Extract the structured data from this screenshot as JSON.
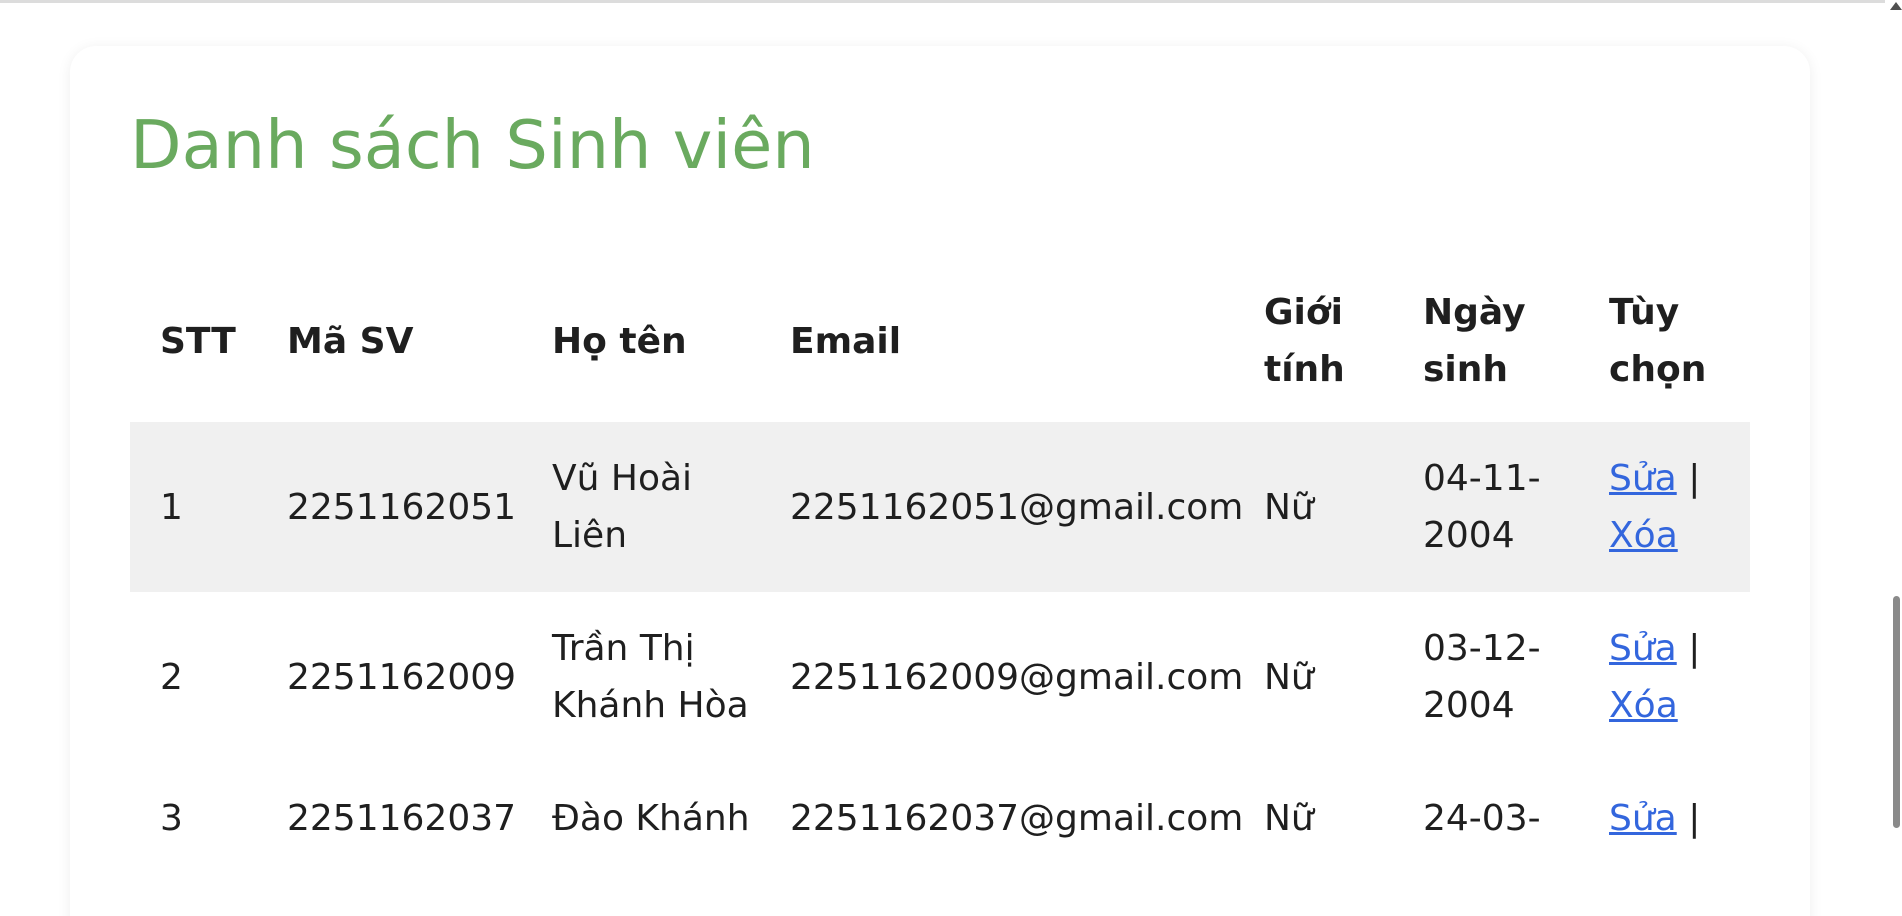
{
  "title": "Danh sách Sinh viên",
  "table": {
    "headers": [
      "STT",
      "Mã SV",
      "Họ tên",
      "Email",
      "Giới tính",
      "Ngày sinh",
      "Tùy chọn"
    ],
    "rows": [
      {
        "stt": "1",
        "masv": "2251162051",
        "hoten": "Vũ Hoài Liên",
        "email": "2251162051@gmail.com",
        "gioitinh": "Nữ",
        "ngaysinh": "04-11-2004",
        "edit": "Sửa",
        "sep": "|",
        "delete": "Xóa"
      },
      {
        "stt": "2",
        "masv": "2251162009",
        "hoten": "Trần Thị Khánh Hòa",
        "email": "2251162009@gmail.com",
        "gioitinh": "Nữ",
        "ngaysinh": "03-12-2004",
        "edit": "Sửa",
        "sep": "|",
        "delete": "Xóa"
      },
      {
        "stt": "3",
        "masv": "2251162037",
        "hoten": "Đào Khánh",
        "email": "2251162037@gmail.com",
        "gioitinh": "Nữ",
        "ngaysinh": "24-03-",
        "edit": "Sửa",
        "sep": "|",
        "delete": ""
      }
    ]
  },
  "colors": {
    "title": "#6aaa5f",
    "stripe": "#f0f0f0",
    "link": "#3366dd"
  },
  "icons": {
    "scroll_up": "scroll-up-arrow-icon"
  }
}
